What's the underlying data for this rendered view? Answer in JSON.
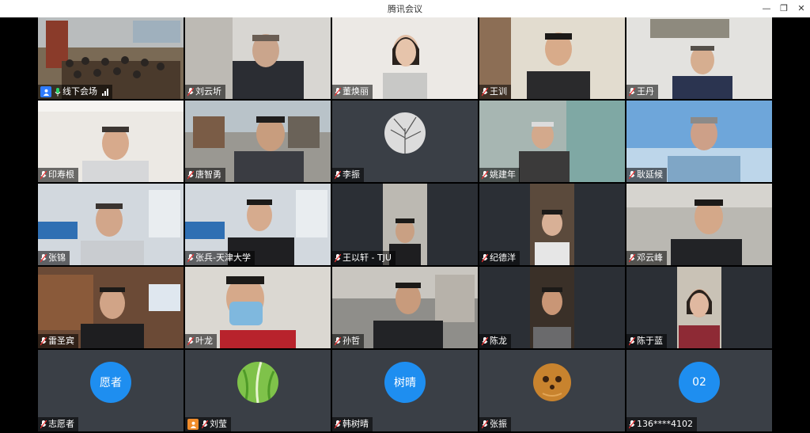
{
  "window": {
    "title": "腾讯会议"
  },
  "participants": [
    {
      "name": "线下会场",
      "kind": "video",
      "bg": "#7a6a55"
    },
    {
      "name": "刘云圻",
      "kind": "video",
      "bg": "#c8c6c0"
    },
    {
      "name": "董焕丽",
      "kind": "video",
      "bg": "#e8e6e2"
    },
    {
      "name": "王训",
      "kind": "video",
      "bg": "#dcd4c6"
    },
    {
      "name": "王丹",
      "kind": "video",
      "bg": "#dcdcd8"
    },
    {
      "name": "印寿根",
      "kind": "video",
      "bg": "#e6e4e0"
    },
    {
      "name": "唐智勇",
      "kind": "video",
      "bg": "#8d8c88"
    },
    {
      "name": "李振",
      "kind": "avatar-image"
    },
    {
      "name": "姚建年",
      "kind": "video",
      "bg": "#a9b8b4"
    },
    {
      "name": "耿延候",
      "kind": "video",
      "bg": "#6fa7d9"
    },
    {
      "name": "张锦",
      "kind": "video",
      "bg": "#cfd6dd"
    },
    {
      "name": "张兵-天津大学",
      "kind": "video",
      "bg": "#cfd6dd"
    },
    {
      "name": "王以轩 - TJU",
      "kind": "video-narrow",
      "bg": "#b8b6b0"
    },
    {
      "name": "纪德洋",
      "kind": "video-narrow",
      "bg": "#5b4a3c"
    },
    {
      "name": "邓云峰",
      "kind": "video",
      "bg": "#b8b6b0"
    },
    {
      "name": "雷圣宾",
      "kind": "video",
      "bg": "#6b4a36"
    },
    {
      "name": "叶龙",
      "kind": "video",
      "bg": "#d9d6d0"
    },
    {
      "name": "孙哲",
      "kind": "video",
      "bg": "#8f8e8a"
    },
    {
      "name": "陈龙",
      "kind": "video-narrow",
      "bg": "#3a3028"
    },
    {
      "name": "陈于蓝",
      "kind": "video-narrow",
      "bg": "#c9c2b6"
    },
    {
      "name": "志愿者",
      "kind": "avatar-text",
      "avatar_text": "愿者"
    },
    {
      "name": "刘莹",
      "kind": "avatar-image-green"
    },
    {
      "name": "韩树晴",
      "kind": "avatar-text",
      "avatar_text": "树晴"
    },
    {
      "name": "张振",
      "kind": "avatar-image-brown"
    },
    {
      "name": "136****4102",
      "kind": "avatar-text",
      "avatar_text": "02"
    }
  ],
  "colors": {
    "accent_blue": "#1e8ef0",
    "active_border": "#2bd36b",
    "stage_bg": "#000000"
  }
}
